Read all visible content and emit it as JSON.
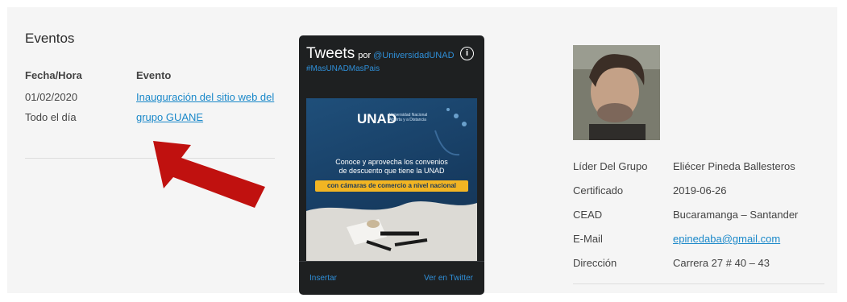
{
  "events": {
    "title": "Eventos",
    "col_date": "Fecha/Hora",
    "col_event": "Evento",
    "row_date": "01/02/2020",
    "row_time": "Todo el día",
    "row_event_line1": "Inauguración del sitio web del",
    "row_event_line2": "grupo GUANE"
  },
  "arrow": {
    "color": "#c0110f"
  },
  "tweets": {
    "title": "Tweets",
    "por": "por",
    "handle": "@UniversidadUNAD",
    "info": "i",
    "hashtag": "#MasUNADMasPais",
    "image": {
      "logo": "UNAD",
      "logo_sub": "Universidad Nacional Abierta y a Distancia",
      "text_line1": "Conoce y aprovecha los convenios",
      "text_line2": "de descuento que tiene la UNAD",
      "badge": "con cámaras de comercio a nivel nacional"
    },
    "embed_link": "Insertar",
    "view_link": "Ver en Twitter"
  },
  "profile": {
    "photo": "profile-photo",
    "lider_label": "Líder Del Grupo",
    "lider_value": "Eliécer Pineda Ballesteros",
    "cert_label": "Certificado",
    "cert_value": "2019-06-26",
    "cead_label": "CEAD",
    "cead_value": "Bucaramanga – Santander",
    "email_label": "E-Mail",
    "email_value": "epinedaba@gmail.com",
    "dir_label": "Dirección",
    "dir_value": "Carrera 27 # 40 – 43"
  }
}
